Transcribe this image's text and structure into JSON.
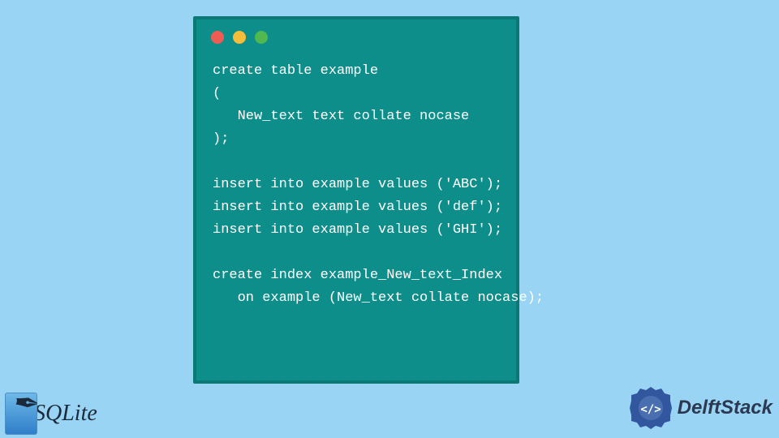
{
  "window": {
    "traffic_lights": [
      "red",
      "yellow",
      "green"
    ]
  },
  "code": "create table example\n(\n   New_text text collate nocase\n);\n\ninsert into example values ('ABC');\ninsert into example values ('def');\ninsert into example values ('GHI');\n\ncreate index example_New_text_Index\n   on example (New_text collate nocase);",
  "logos": {
    "sqlite": "SQLite",
    "delft": "DelftStack"
  }
}
